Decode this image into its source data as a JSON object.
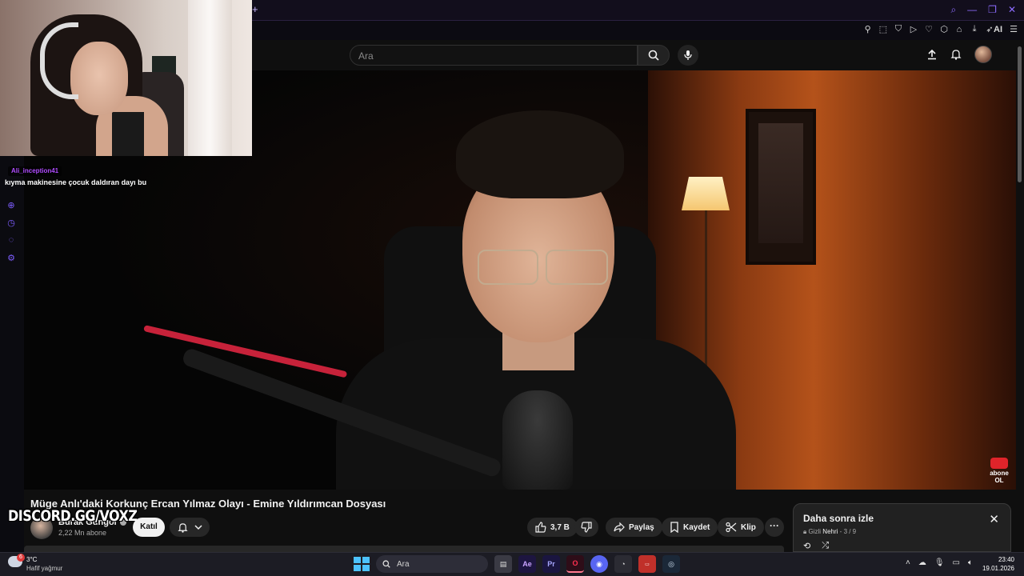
{
  "browser": {
    "new_tab": "+",
    "extensions": [
      "pin-icon",
      "screenshot-icon",
      "shield-icon",
      "play-icon",
      "heart-icon",
      "extensions-icon",
      "profile-icon",
      "download-icon",
      "send-icon"
    ],
    "ai_label": "AI"
  },
  "youtube": {
    "search_placeholder": "Ara",
    "video": {
      "title": "Müge Anlı'daki Korkunç Ercan Yılmaz Olayı - Emine Yıldırımcan Dosyası",
      "channel": "Burak Güngör",
      "subscribers": "2,22 Mn abone",
      "join_label": "Katıl",
      "likes": "3,7 B",
      "share_label": "Paylaş",
      "save_label": "Kaydet",
      "clip_label": "Klip",
      "more_label": "···"
    },
    "subscribe_badge": {
      "line1": "abone",
      "line2": "OL"
    },
    "watch_later": {
      "title": "Daha sonra izle",
      "privacy": "Gizli",
      "owner": "Nehri",
      "position": "3 / 9"
    }
  },
  "stream_overlay": {
    "chat_user": "Ali_inception41",
    "chat_message": "kıyma makinesine çocuk daldıran dayı bu",
    "discord": "DISCORD.GG/VOXZ"
  },
  "taskbar": {
    "weather_temp": "3°C",
    "weather_desc": "Hafif yağmur",
    "weather_badge": "6",
    "search_label": "Ara",
    "time": "23:40",
    "date": "19.01.2026"
  }
}
